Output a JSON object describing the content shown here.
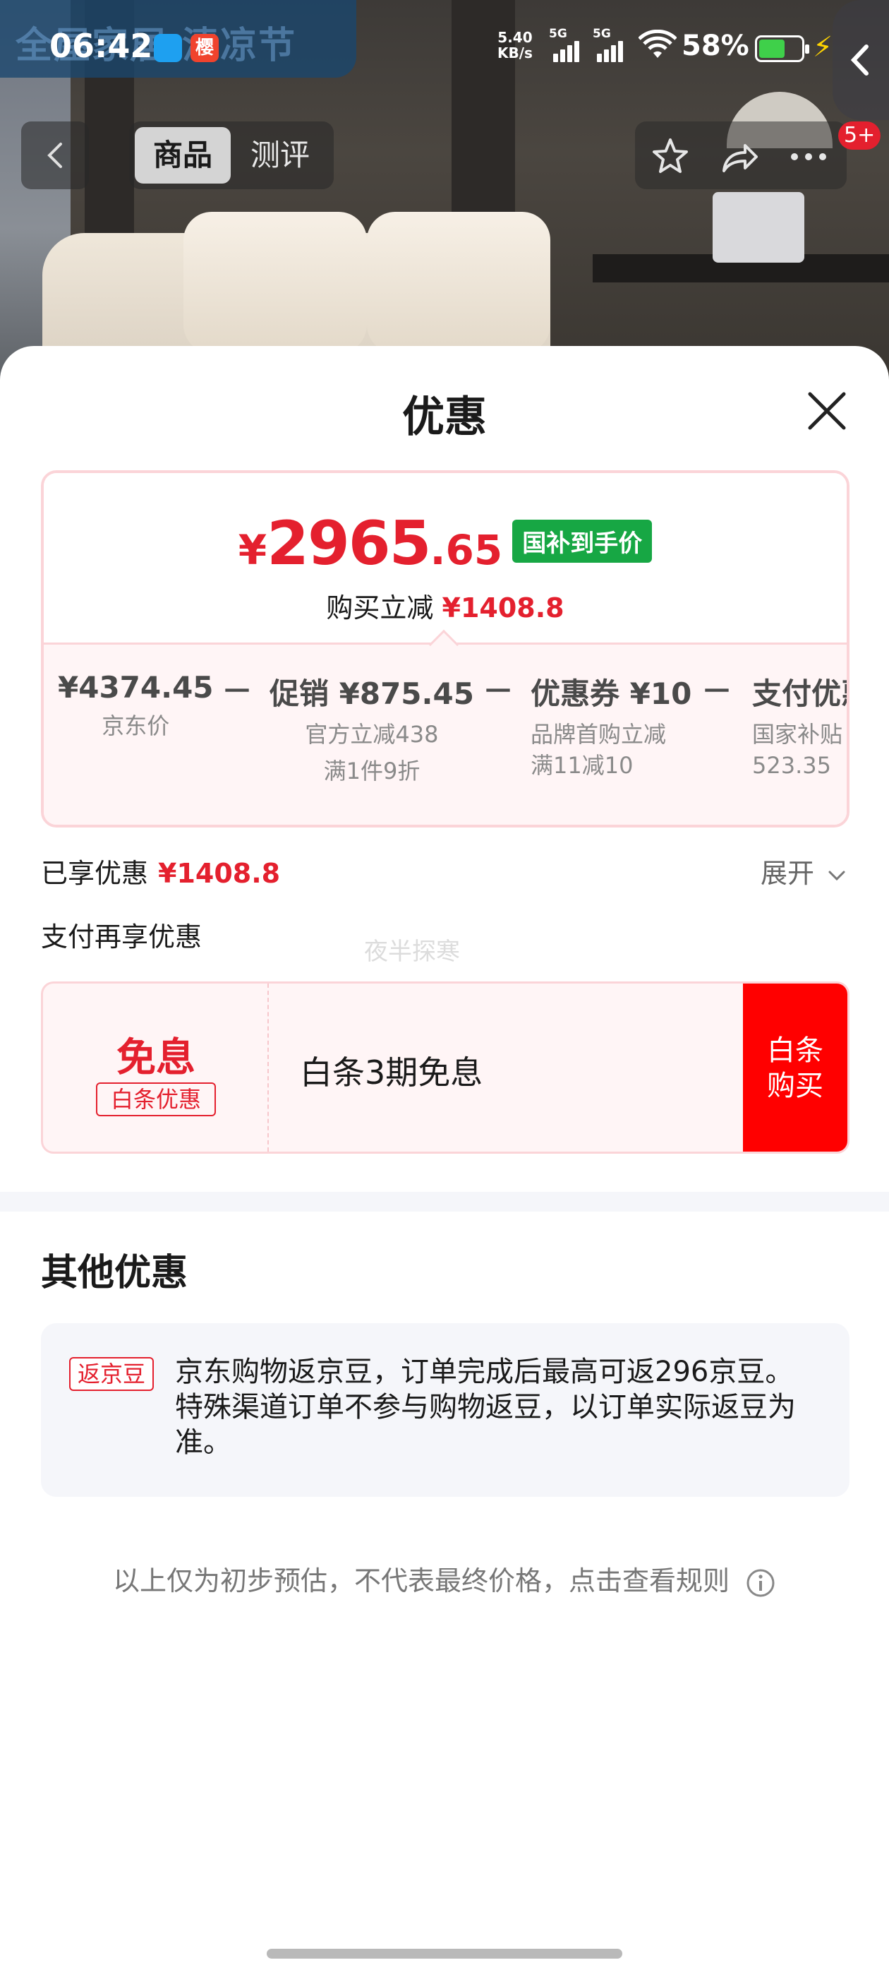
{
  "status_bar": {
    "time": "06:42",
    "notif_char": "樱",
    "net_speed_value": "5.40",
    "net_speed_unit": "KB/s",
    "signal_1_label": "5G",
    "signal_2_label": "5G",
    "battery_percent": "58%"
  },
  "background": {
    "banner_text": "全屋家居 清凉节"
  },
  "nav": {
    "tabs": [
      {
        "label": "商品"
      },
      {
        "label": "测评"
      }
    ],
    "badge": "5+"
  },
  "sheet": {
    "title": "优惠",
    "price": {
      "currency": "¥",
      "integer": "2965",
      "decimal": ".65",
      "tag": "国补到手价",
      "reduce_label": "购买立减",
      "reduce_amount": "¥1408.8"
    },
    "breakdown": [
      {
        "head": "¥4374.45",
        "sub1": "京东价",
        "sub2": ""
      },
      {
        "head": "促销 ¥875.45",
        "sub1": "官方立减438",
        "sub2": "满1件9折"
      },
      {
        "head": "优惠券 ¥10",
        "sub1": "品牌首购立减",
        "sub2": "满11减10"
      },
      {
        "head": "支付优惠",
        "sub1": "国家补贴",
        "sub2": "523.35"
      }
    ],
    "operator": "－",
    "enjoyed_label": "已享优惠",
    "enjoyed_amount": "¥1408.8",
    "expand_label": "展开",
    "pay_more_label": "支付再享优惠",
    "watermark": "夜半探寒",
    "offer": {
      "big_label": "免息",
      "tag_label": "白条优惠",
      "description": "白条3期免息",
      "button_line1": "白条",
      "button_line2": "购买"
    },
    "other": {
      "title": "其他优惠",
      "badge": "返京豆",
      "text": "京东购物返京豆，订单完成后最高可返296京豆。特殊渠道订单不参与购物返豆，以订单实际返豆为准。"
    },
    "footnote": "以上仅为初步预估，不代表最终价格，点击查看规则"
  },
  "colors": {
    "accent_red": "#e4202e",
    "button_red": "#ff0000",
    "tag_green": "#17a744",
    "card_pink_bg": "#fff5f6",
    "card_pink_border": "#fbd4d8"
  },
  "icons": [
    "back-icon",
    "star-icon",
    "share-icon",
    "more-icon",
    "close-icon",
    "chevron-down-icon",
    "info-icon",
    "wifi-icon",
    "battery-icon",
    "charging-bolt-icon"
  ]
}
